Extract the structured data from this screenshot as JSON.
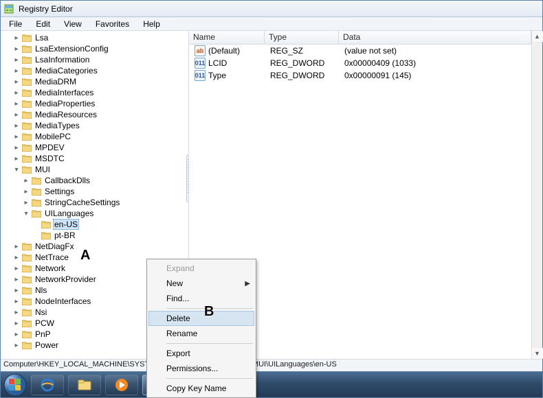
{
  "title": "Registry Editor",
  "menu": {
    "items": [
      "File",
      "Edit",
      "View",
      "Favorites",
      "Help"
    ]
  },
  "tree": {
    "top": [
      {
        "label": "Lsa",
        "depth": 5,
        "tw": "r"
      },
      {
        "label": "LsaExtensionConfig",
        "depth": 5,
        "tw": "r"
      },
      {
        "label": "LsaInformation",
        "depth": 5,
        "tw": "r"
      },
      {
        "label": "MediaCategories",
        "depth": 5,
        "tw": "r"
      },
      {
        "label": "MediaDRM",
        "depth": 5,
        "tw": "r"
      },
      {
        "label": "MediaInterfaces",
        "depth": 5,
        "tw": "r"
      },
      {
        "label": "MediaProperties",
        "depth": 5,
        "tw": "r"
      },
      {
        "label": "MediaResources",
        "depth": 5,
        "tw": "r"
      },
      {
        "label": "MediaTypes",
        "depth": 5,
        "tw": "r"
      },
      {
        "label": "MobilePC",
        "depth": 5,
        "tw": "r"
      },
      {
        "label": "MPDEV",
        "depth": 5,
        "tw": "r"
      },
      {
        "label": "MSDTC",
        "depth": 5,
        "tw": "r"
      },
      {
        "label": "MUI",
        "depth": 5,
        "tw": "d"
      },
      {
        "label": "CallbackDlls",
        "depth": 6,
        "tw": "r"
      },
      {
        "label": "Settings",
        "depth": 6,
        "tw": "r"
      },
      {
        "label": "StringCacheSettings",
        "depth": 6,
        "tw": "r"
      },
      {
        "label": "UILanguages",
        "depth": 6,
        "tw": "d"
      },
      {
        "label": "en-US",
        "depth": 7,
        "tw": "",
        "selected": true
      },
      {
        "label": "pt-BR",
        "depth": 7,
        "tw": ""
      },
      {
        "label": "NetDiagFx",
        "depth": 5,
        "tw": "r"
      },
      {
        "label": "NetTrace",
        "depth": 5,
        "tw": "r"
      },
      {
        "label": "Network",
        "depth": 5,
        "tw": "r"
      },
      {
        "label": "NetworkProvider",
        "depth": 5,
        "tw": "r"
      },
      {
        "label": "Nls",
        "depth": 5,
        "tw": "r"
      },
      {
        "label": "NodeInterfaces",
        "depth": 5,
        "tw": "r"
      },
      {
        "label": "Nsi",
        "depth": 5,
        "tw": "r"
      },
      {
        "label": "PCW",
        "depth": 5,
        "tw": "r"
      },
      {
        "label": "PnP",
        "depth": 5,
        "tw": "r"
      },
      {
        "label": "Power",
        "depth": 5,
        "tw": "r"
      }
    ]
  },
  "list": {
    "columns": {
      "name": "Name",
      "type": "Type",
      "data": "Data"
    },
    "rows": [
      {
        "kind": "sz",
        "name": "(Default)",
        "type": "REG_SZ",
        "data": "(value not set)"
      },
      {
        "kind": "dw",
        "name": "LCID",
        "type": "REG_DWORD",
        "data": "0x00000409 (1033)"
      },
      {
        "kind": "dw",
        "name": "Type",
        "type": "REG_DWORD",
        "data": "0x00000091 (145)"
      }
    ]
  },
  "context_menu": {
    "items": [
      {
        "label": "Expand",
        "disabled": true
      },
      {
        "label": "New",
        "submenu": true
      },
      {
        "label": "Find..."
      },
      {
        "sep": true
      },
      {
        "label": "Delete",
        "hover": true
      },
      {
        "label": "Rename"
      },
      {
        "sep": true
      },
      {
        "label": "Export"
      },
      {
        "label": "Permissions..."
      },
      {
        "sep": true
      },
      {
        "label": "Copy Key Name"
      }
    ]
  },
  "status_path": "Computer\\HKEY_LOCAL_MACHINE\\SYSTEM\\CurrentControlSet\\Control\\MUI\\UILanguages\\en-US",
  "markers": {
    "A": "A",
    "B": "B"
  },
  "taskbar": {
    "items": [
      {
        "name": "start",
        "active": false
      },
      {
        "name": "ie",
        "active": false
      },
      {
        "name": "explorer",
        "active": false
      },
      {
        "name": "wmplayer",
        "active": false
      },
      {
        "name": "regedit",
        "active": true
      }
    ]
  }
}
